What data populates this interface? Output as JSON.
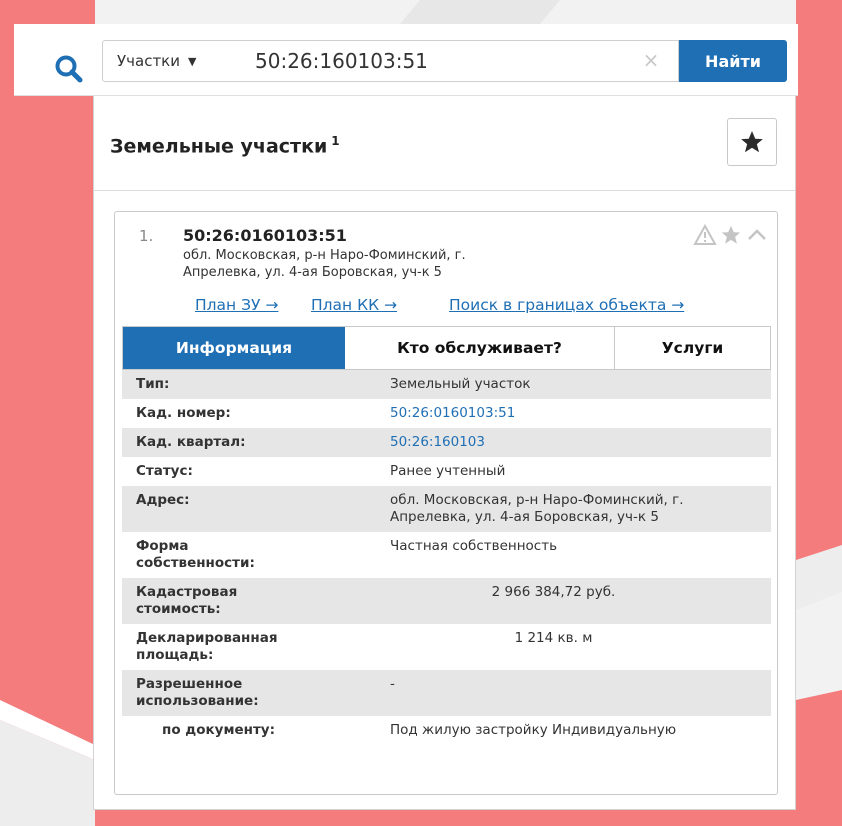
{
  "search": {
    "type_label": "Участки",
    "query": "50:26:160103:51",
    "clear_symbol": "×",
    "submit_label": "Найти"
  },
  "panel": {
    "title": "Земельные участки",
    "count": "1"
  },
  "result": {
    "index": "1.",
    "cad_number": "50:26:0160103:51",
    "address_line1": "обл. Московская, р-н Наро-Фоминский, г.",
    "address_line2": "Апрелевка, ул. 4-ая Боровская, уч-к 5",
    "links": {
      "plan_zu": "План ЗУ →",
      "plan_kk": "План КК →",
      "search_in_bounds": "Поиск в границах объекта →"
    },
    "tabs": [
      "Информация",
      "Кто обслуживает?",
      "Услуги"
    ],
    "info": {
      "type_label": "Тип:",
      "type_value": "Земельный участок",
      "cad_label": "Кад. номер:",
      "cad_value": "50:26:0160103:51",
      "quarter_label": "Кад. квартал:",
      "quarter_value": "50:26:160103",
      "status_label": "Статус:",
      "status_value": "Ранее учтенный",
      "address_label": "Адрес:",
      "address_value_1": "обл. Московская, р-н Наро-Фоминский, г.",
      "address_value_2": "Апрелевка, ул. 4-ая Боровская, уч-к 5",
      "ownership_label_1": "Форма",
      "ownership_label_2": "собственности:",
      "ownership_value": "Частная собственность",
      "cost_label_1": "Кадастровая",
      "cost_label_2": "стоимость:",
      "cost_value": "2 966 384,72 руб.",
      "area_label_1": "Декларированная",
      "area_label_2": "площадь:",
      "area_value": "1 214 кв. м",
      "usage_label_1": "Разрешенное",
      "usage_label_2": "использование:",
      "usage_value": "-",
      "by_doc_label": "по документу:",
      "by_doc_value": "Под жилую застройку Индивидуальную"
    }
  },
  "colors": {
    "accent": "#1f6fb5",
    "map_parcel": "#f47c7c",
    "row_alt": "#e6e6e6"
  },
  "icons": {
    "search": "search-icon",
    "favorite": "star-icon",
    "warning": "warning-icon",
    "collapse": "chevron-up-icon"
  }
}
